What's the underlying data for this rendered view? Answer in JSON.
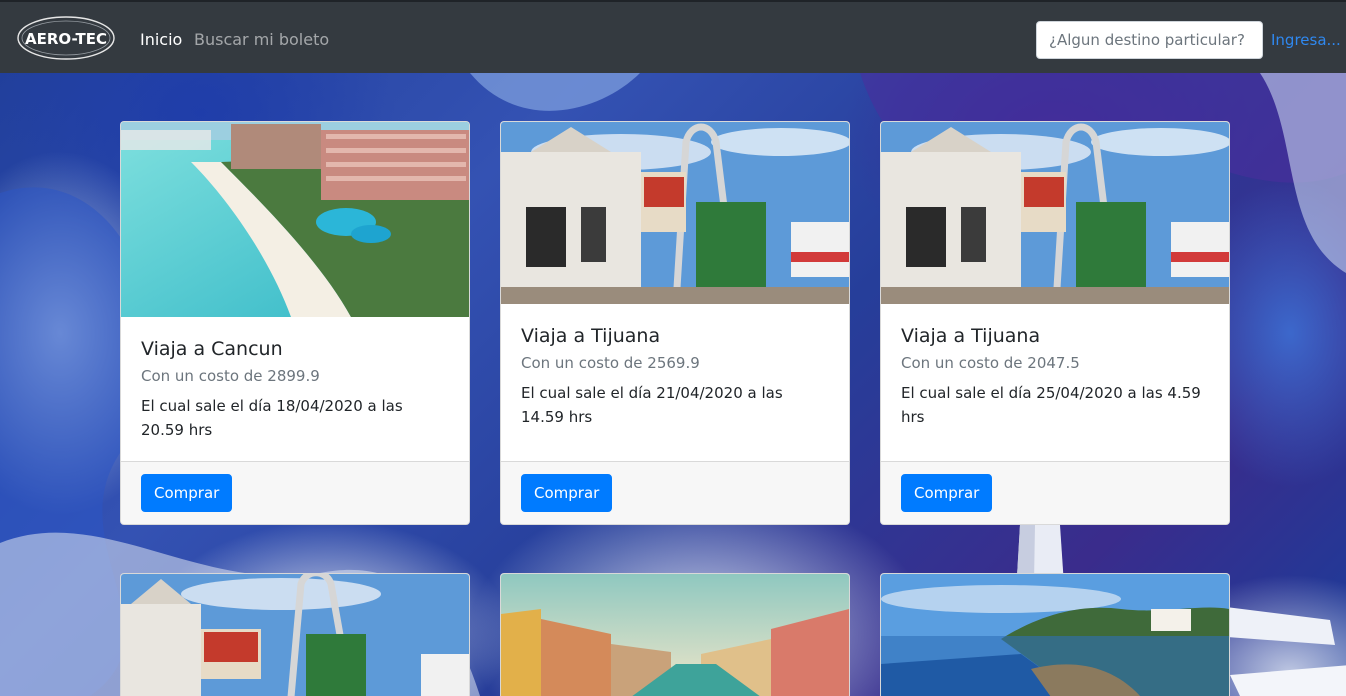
{
  "navbar": {
    "logo_text": "AERO-TEC",
    "links": [
      {
        "label": "Inicio"
      },
      {
        "label": "Buscar mi boleto"
      }
    ],
    "search_placeholder": "¿Algun destino particular?",
    "login_label": "Ingresa..."
  },
  "cards": [
    {
      "title": "Viaja a Cancun",
      "cost": "Con un costo de 2899.9",
      "departure": "El cual sale el día 18/04/2020 a las 20.59 hrs",
      "button": "Comprar"
    },
    {
      "title": "Viaja a Tijuana",
      "cost": "Con un costo de 2569.9",
      "departure": "El cual sale el día 21/04/2020 a las 14.59 hrs",
      "button": "Comprar"
    },
    {
      "title": "Viaja a Tijuana",
      "cost": "Con un costo de 2047.5",
      "departure": "El cual sale el día 25/04/2020 a las 4.59 hrs",
      "button": "Comprar"
    }
  ],
  "colors": {
    "navbar_bg": "#343a40",
    "primary": "#007bff",
    "link": "#2f88f0"
  }
}
